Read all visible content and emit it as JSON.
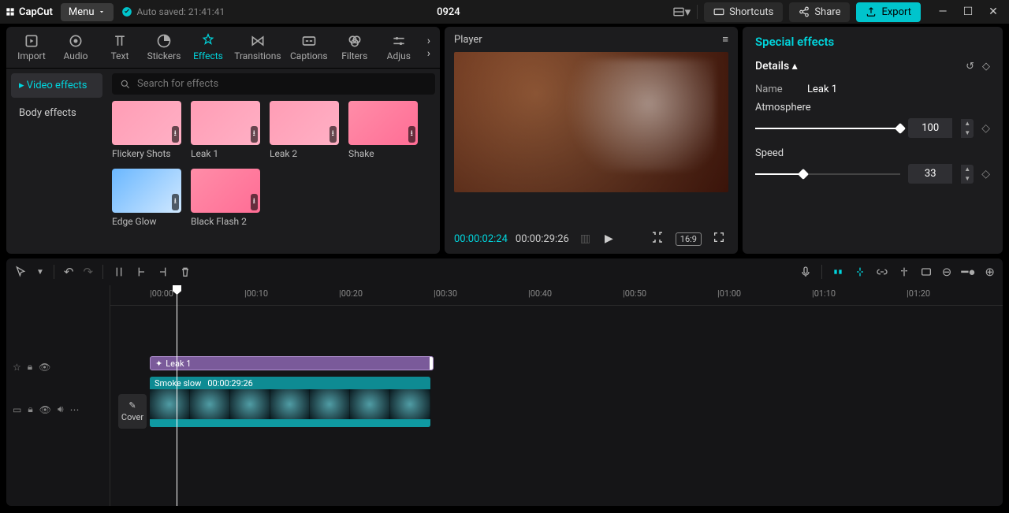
{
  "titlebar": {
    "logo": "CapCut",
    "menu": "Menu",
    "autosave": "Auto saved: 21:41:41",
    "project_name": "0924",
    "shortcuts": "Shortcuts",
    "share": "Share",
    "export": "Export"
  },
  "tool_tabs": [
    "Import",
    "Audio",
    "Text",
    "Stickers",
    "Effects",
    "Transitions",
    "Captions",
    "Filters",
    "Adjus"
  ],
  "active_tab_index": 4,
  "effect_categories": {
    "video": "Video effects",
    "body": "Body effects"
  },
  "search_placeholder": "Search for effects",
  "effects": [
    {
      "label": "Flickery Shots"
    },
    {
      "label": "Leak 1"
    },
    {
      "label": "Leak 2"
    },
    {
      "label": "Shake"
    },
    {
      "label": "Edge Glow"
    },
    {
      "label": "Black Flash 2"
    }
  ],
  "player": {
    "title": "Player",
    "current": "00:00:02:24",
    "total": "00:00:29:26",
    "ratio": "16:9"
  },
  "inspector": {
    "title": "Special effects",
    "details": "Details",
    "name_label": "Name",
    "name_value": "Leak 1",
    "atmosphere_label": "Atmosphere",
    "atmosphere_value": "100",
    "speed_label": "Speed",
    "speed_value": "33"
  },
  "timeline": {
    "ruler": [
      "00:00",
      "00:10",
      "00:20",
      "00:30",
      "00:40",
      "00:50",
      "01:00",
      "01:10",
      "01:20"
    ],
    "cover": "Cover",
    "effect_clip": {
      "name": "Leak 1"
    },
    "video_clip": {
      "name": "Smoke slow",
      "duration": "00:00:29:26"
    }
  }
}
